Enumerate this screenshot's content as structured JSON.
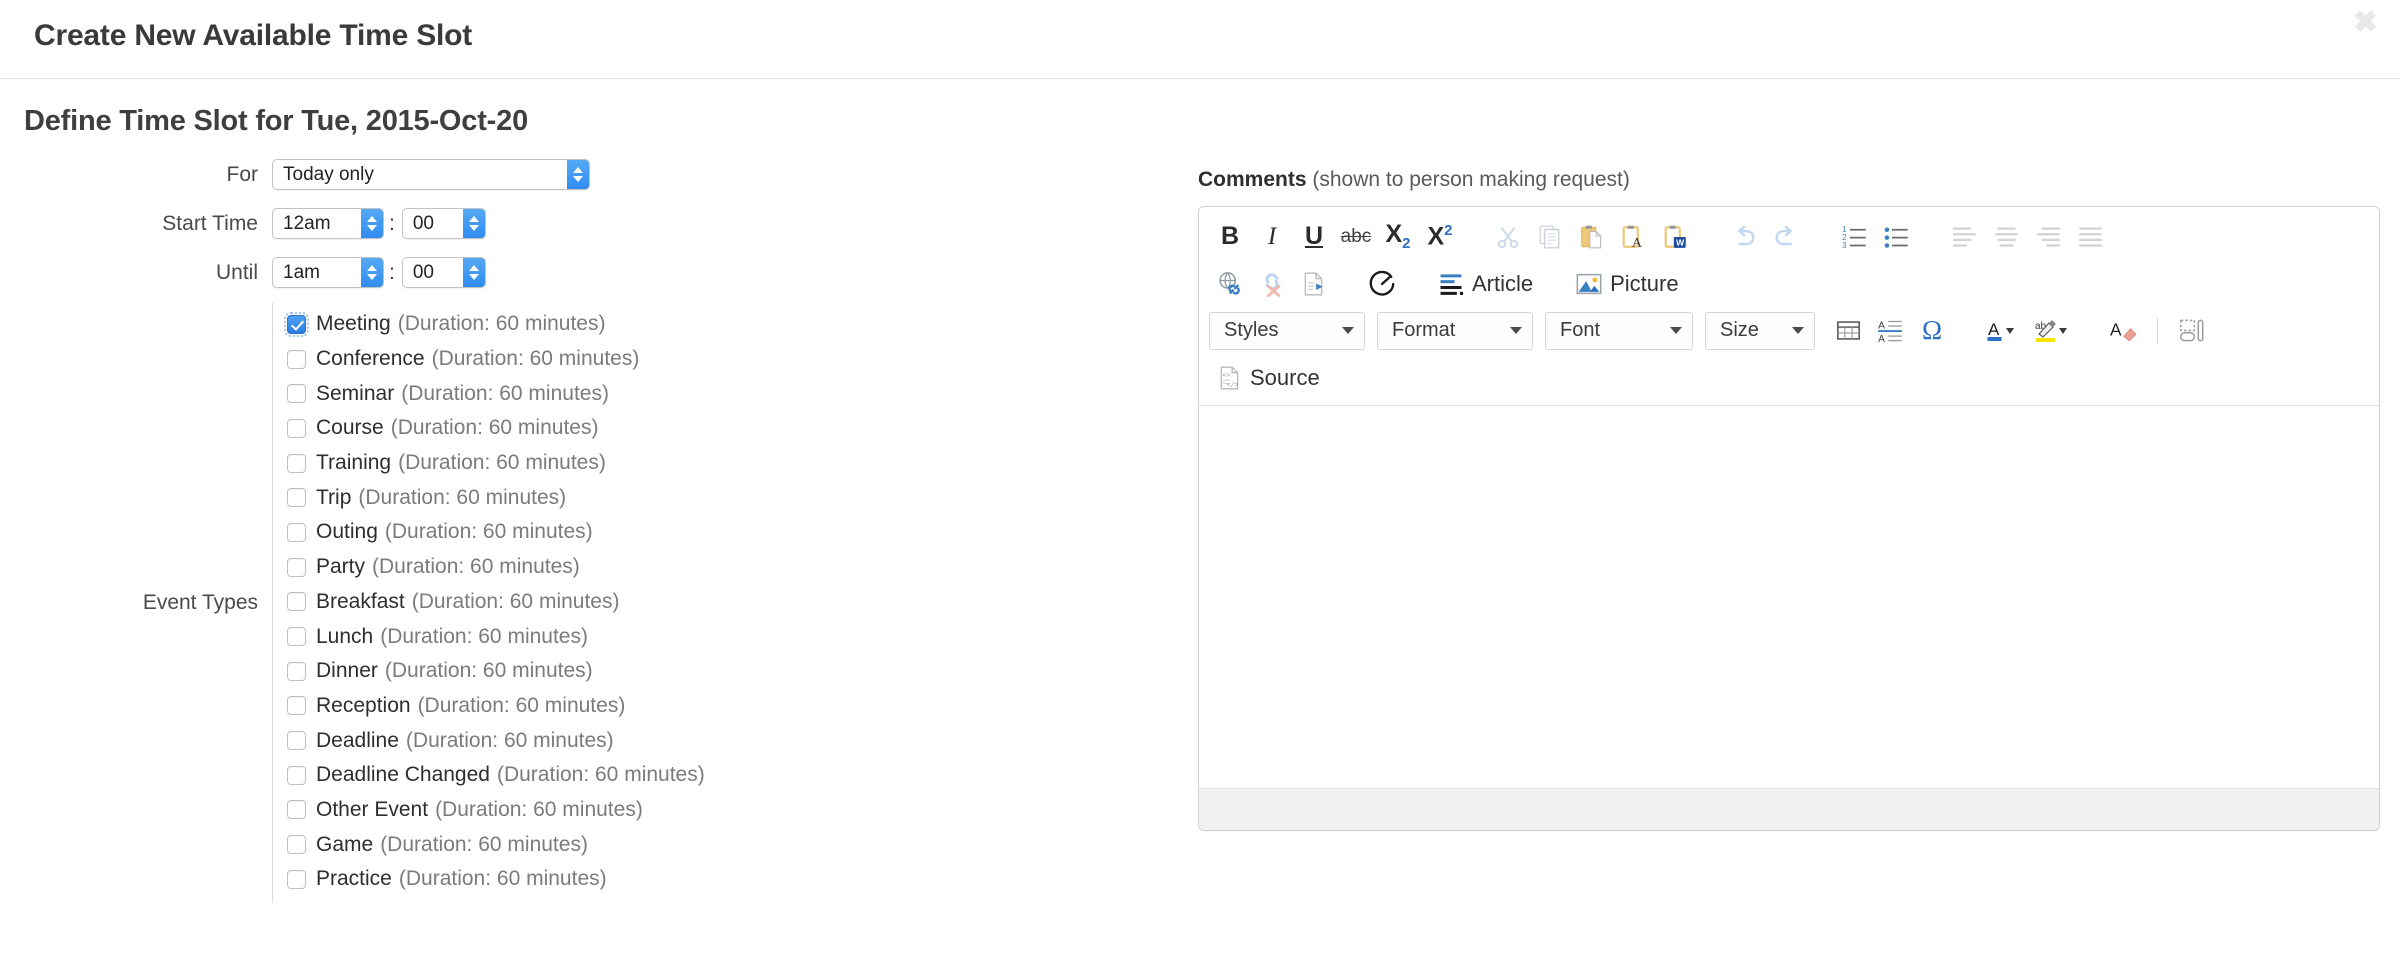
{
  "modal": {
    "title": "Create New Available Time Slot",
    "close_label": "✖"
  },
  "heading": "Define Time Slot for Tue, 2015-Oct-20",
  "form": {
    "for": {
      "label": "For",
      "value": "Today only"
    },
    "start_time": {
      "label": "Start Time",
      "hour": "12am",
      "minute": "00",
      "separator": ":"
    },
    "until": {
      "label": "Until",
      "hour": "1am",
      "minute": "00",
      "separator": ":"
    },
    "event_types": {
      "label": "Event Types",
      "items": [
        {
          "name": "Meeting",
          "duration": "(Duration: 60 minutes)",
          "checked": true
        },
        {
          "name": "Conference",
          "duration": "(Duration: 60 minutes)",
          "checked": false
        },
        {
          "name": "Seminar",
          "duration": "(Duration: 60 minutes)",
          "checked": false
        },
        {
          "name": "Course",
          "duration": "(Duration: 60 minutes)",
          "checked": false
        },
        {
          "name": "Training",
          "duration": "(Duration: 60 minutes)",
          "checked": false
        },
        {
          "name": "Trip",
          "duration": "(Duration: 60 minutes)",
          "checked": false
        },
        {
          "name": "Outing",
          "duration": "(Duration: 60 minutes)",
          "checked": false
        },
        {
          "name": "Party",
          "duration": "(Duration: 60 minutes)",
          "checked": false
        },
        {
          "name": "Breakfast",
          "duration": "(Duration: 60 minutes)",
          "checked": false
        },
        {
          "name": "Lunch",
          "duration": "(Duration: 60 minutes)",
          "checked": false
        },
        {
          "name": "Dinner",
          "duration": "(Duration: 60 minutes)",
          "checked": false
        },
        {
          "name": "Reception",
          "duration": "(Duration: 60 minutes)",
          "checked": false
        },
        {
          "name": "Deadline",
          "duration": "(Duration: 60 minutes)",
          "checked": false
        },
        {
          "name": "Deadline Changed",
          "duration": "(Duration: 60 minutes)",
          "checked": false
        },
        {
          "name": "Other Event",
          "duration": "(Duration: 60 minutes)",
          "checked": false
        },
        {
          "name": "Game",
          "duration": "(Duration: 60 minutes)",
          "checked": false
        },
        {
          "name": "Practice",
          "duration": "(Duration: 60 minutes)",
          "checked": false
        }
      ]
    }
  },
  "comments": {
    "title": "Comments",
    "note": "(shown to person making request)",
    "editor": {
      "toolbar_row1": [
        {
          "icon": "bold-icon",
          "label": "B",
          "enabled": true
        },
        {
          "icon": "italic-icon",
          "label": "I",
          "enabled": true
        },
        {
          "icon": "underline-icon",
          "label": "U",
          "enabled": true
        },
        {
          "icon": "strikethrough-icon",
          "label": "abc",
          "enabled": true
        },
        {
          "icon": "subscript-icon",
          "label": "X2",
          "enabled": true
        },
        {
          "icon": "superscript-icon",
          "label": "X2",
          "enabled": true
        },
        {
          "icon": "cut-icon",
          "label": "Cut",
          "enabled": false
        },
        {
          "icon": "copy-icon",
          "label": "Copy",
          "enabled": false
        },
        {
          "icon": "paste-icon",
          "label": "Paste",
          "enabled": true
        },
        {
          "icon": "paste-text-icon",
          "label": "Paste as plain text",
          "enabled": true
        },
        {
          "icon": "paste-word-icon",
          "label": "Paste from Word",
          "enabled": true
        },
        {
          "icon": "undo-icon",
          "label": "Undo",
          "enabled": false
        },
        {
          "icon": "redo-icon",
          "label": "Redo",
          "enabled": false
        },
        {
          "icon": "numbered-list-icon",
          "label": "Insert/Remove Numbered List",
          "enabled": true
        },
        {
          "icon": "bulleted-list-icon",
          "label": "Insert/Remove Bulleted List",
          "enabled": true
        },
        {
          "icon": "align-left-icon",
          "label": "Align Left",
          "enabled": false
        },
        {
          "icon": "align-center-icon",
          "label": "Center",
          "enabled": false
        },
        {
          "icon": "align-right-icon",
          "label": "Align Right",
          "enabled": false
        },
        {
          "icon": "justify-icon",
          "label": "Justify",
          "enabled": false
        }
      ],
      "toolbar_row2": [
        {
          "icon": "link-icon",
          "label": "Link",
          "enabled": true
        },
        {
          "icon": "unlink-icon",
          "label": "Unlink",
          "enabled": false
        },
        {
          "icon": "anchor-icon",
          "label": "Anchor",
          "enabled": true
        },
        {
          "icon": "clock-icon",
          "label": "Insert Time",
          "enabled": true
        },
        {
          "icon": "article-icon",
          "label": "Article",
          "enabled": true
        },
        {
          "icon": "picture-icon",
          "label": "Picture",
          "enabled": true
        }
      ],
      "combos": [
        {
          "name": "styles",
          "label": "Styles"
        },
        {
          "name": "format",
          "label": "Format"
        },
        {
          "name": "font",
          "label": "Font"
        },
        {
          "name": "size",
          "label": "Size"
        }
      ],
      "toolbar_row3_icons": [
        {
          "icon": "table-icon",
          "label": "Table",
          "enabled": true
        },
        {
          "icon": "line-height-icon",
          "label": "Line Height",
          "enabled": true
        },
        {
          "icon": "special-char-icon",
          "label": "Insert Special Character",
          "enabled": true
        },
        {
          "icon": "text-color-icon",
          "label": "Text Color",
          "enabled": true
        },
        {
          "icon": "highlight-color-icon",
          "label": "Background Color",
          "enabled": true
        },
        {
          "icon": "remove-format-icon",
          "label": "Remove Format",
          "enabled": true
        },
        {
          "icon": "show-blocks-icon",
          "label": "Show Blocks",
          "enabled": true
        }
      ],
      "source_button": {
        "icon": "source-icon",
        "label": "Source"
      },
      "content": ""
    }
  },
  "colors": {
    "accent_blue": "#2f8cf0",
    "toolbar_blue": "#3a7fc1",
    "highlight_yellow": "#f7e400",
    "text_dark": "#2e2e2e",
    "text_muted": "#7b7b7b",
    "border": "#d2d2d2"
  }
}
